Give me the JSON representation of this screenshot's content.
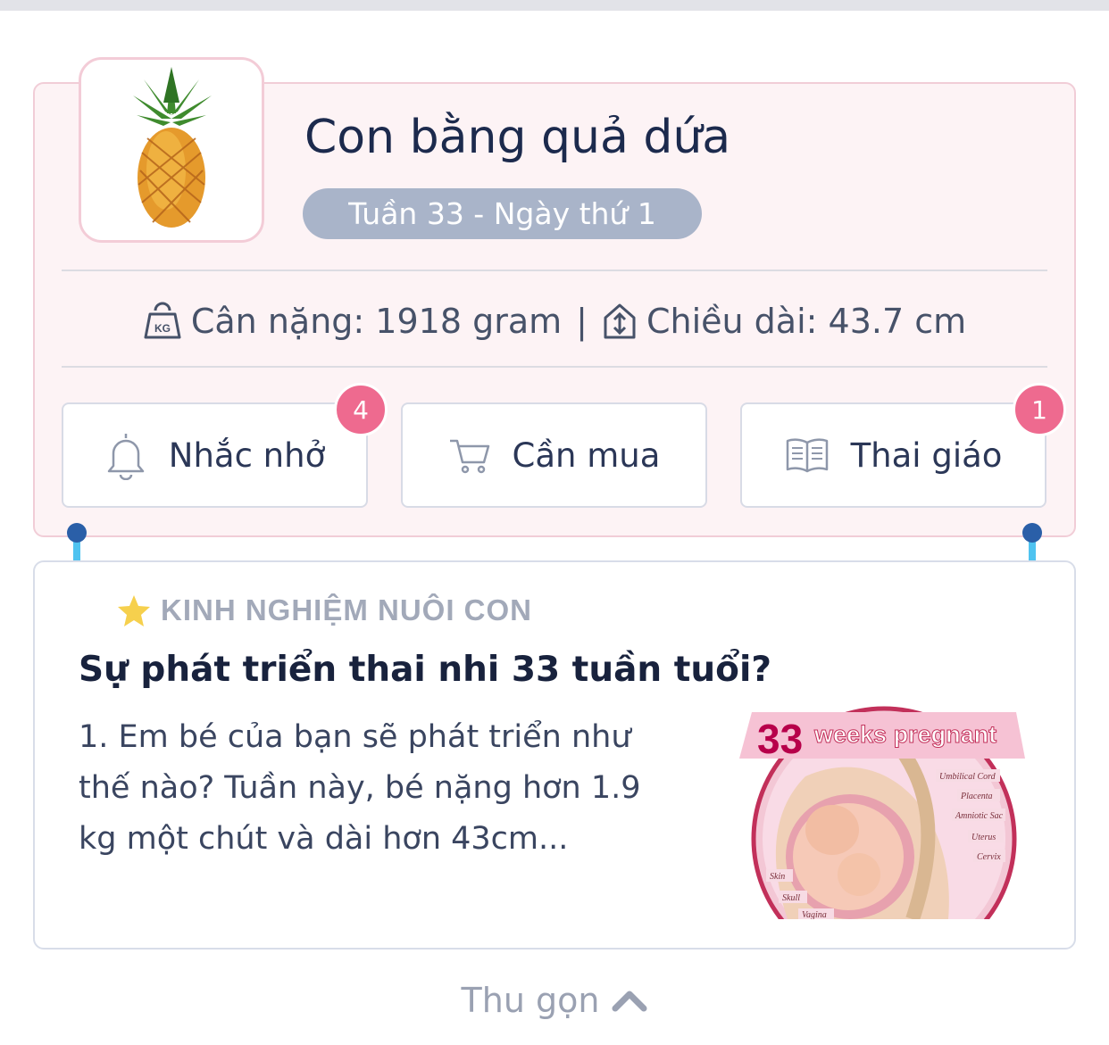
{
  "baby": {
    "title": "Con bằng quả dứa",
    "fruit_icon": "pineapple",
    "week_label": "Tuần 33 - Ngày thứ 1",
    "weight_text": "Cân nặng: 1918 gram",
    "separator": "|",
    "length_text": "Chiều dài: 43.7 cm"
  },
  "actions": [
    {
      "label": "Nhắc nhở",
      "icon": "bell-icon",
      "badge": "4"
    },
    {
      "label": "Cần mua",
      "icon": "cart-icon"
    },
    {
      "label": "Thai giáo",
      "icon": "book-icon",
      "badge": "1"
    }
  ],
  "article": {
    "section_label": "KINH NGHIỆM NUÔI CON",
    "title": "Sự phát triển thai nhi 33 tuần tuổi?",
    "excerpt_lines": [
      "1. Em bé của bạn sẽ phát triển như",
      "thế nào? Tuần này, bé nặng hơn 1.9",
      "kg một chút và dài hơn 43cm..."
    ],
    "image": {
      "week_number": "33",
      "caption": "weeks pregnant",
      "labels": [
        "Umbilical Cord",
        "Placenta",
        "Amniotic Sac",
        "Uterus",
        "Cervix",
        "Skin",
        "Skull",
        "Vagina"
      ]
    }
  },
  "collapse_label": "Thu gọn",
  "colors": {
    "accent_pink": "#ee6a8f",
    "pill_gray": "#a9b4c9",
    "connector_blue": "#4fc3f0",
    "connector_dot": "#2a5fa8"
  }
}
